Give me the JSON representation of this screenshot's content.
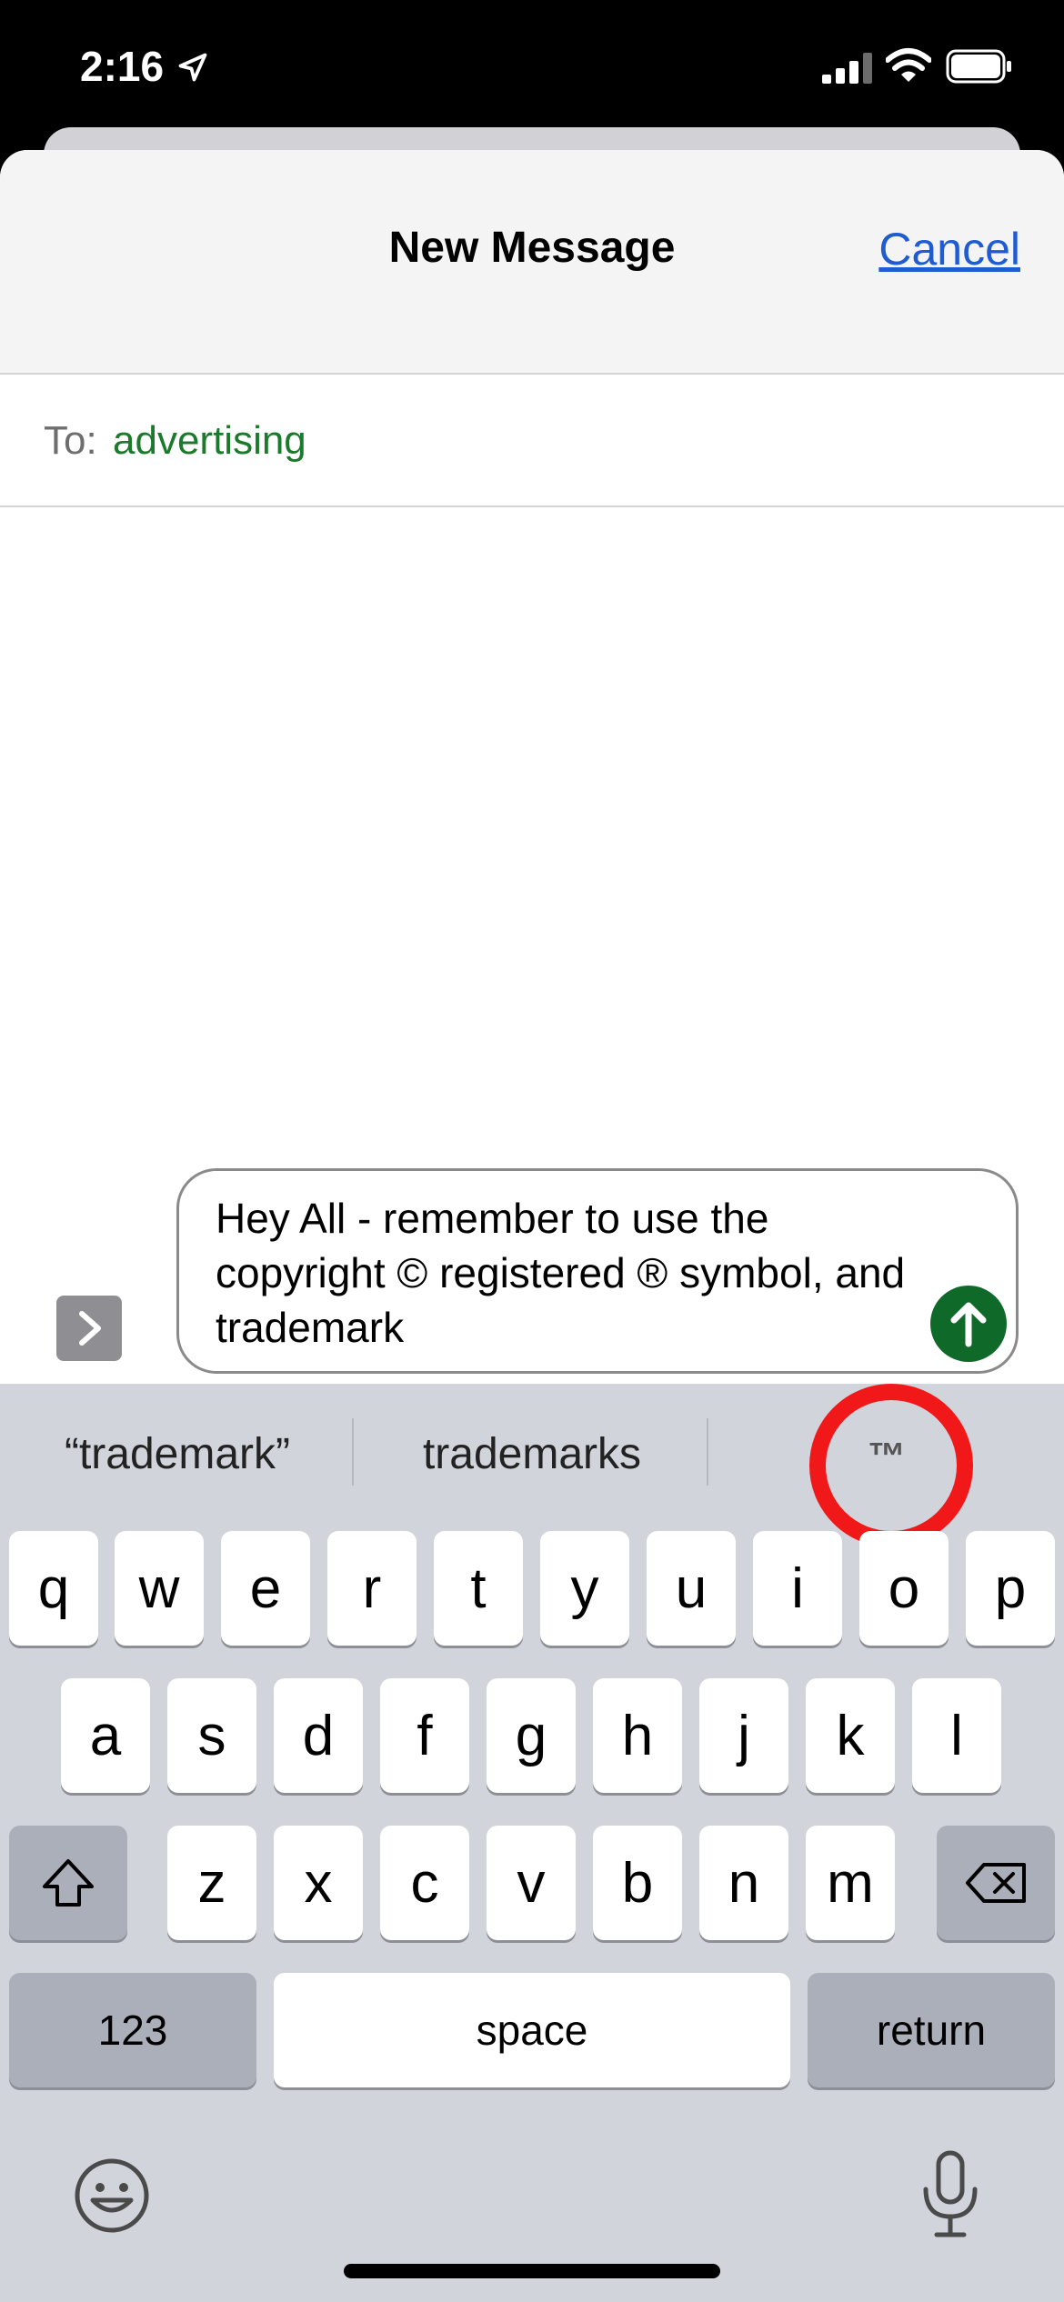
{
  "status_bar": {
    "time": "2:16"
  },
  "nav": {
    "title": "New Message",
    "cancel_label": "Cancel"
  },
  "to": {
    "label": "To:",
    "value": "advertising"
  },
  "compose": {
    "text": "Hey All - remember to use the copyright © registered ® symbol, and trademark"
  },
  "suggestions": [
    "“trademark”",
    "trademarks",
    "™"
  ],
  "keyboard": {
    "row1": [
      "q",
      "w",
      "e",
      "r",
      "t",
      "y",
      "u",
      "i",
      "o",
      "p"
    ],
    "row2": [
      "a",
      "s",
      "d",
      "f",
      "g",
      "h",
      "j",
      "k",
      "l"
    ],
    "row3": [
      "z",
      "x",
      "c",
      "v",
      "b",
      "n",
      "m"
    ],
    "numbers_label": "123",
    "space_label": "space",
    "return_label": "return"
  },
  "colors": {
    "accent_green": "#0f6a2a",
    "recipient_green": "#1b7a2c",
    "cancel_blue": "#1f5bd1",
    "annotation_red": "#f01818"
  }
}
